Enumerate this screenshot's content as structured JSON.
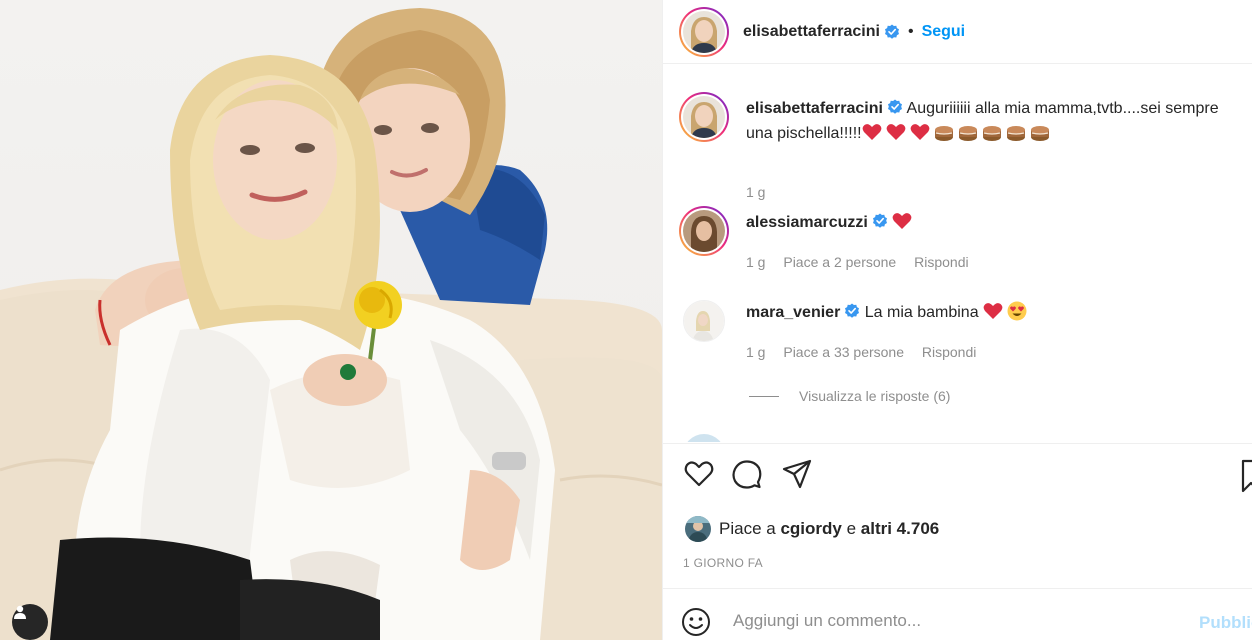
{
  "post": {
    "author": "elisabettaferracini",
    "follow_label": "Segui",
    "separator": "•"
  },
  "comments": [
    {
      "username": "elisabettaferracini",
      "text_line1": "Auguriiiiii alla mia mamma,tvtb....sei sempre",
      "text_line2": "una pischella!!!!!",
      "time": "1 g"
    },
    {
      "username": "alessiamarcuzzi",
      "time": "1 g",
      "likes": "Piace a 2 persone",
      "reply": "Rispondi"
    },
    {
      "username": "mara_venier",
      "text": "La mia bambina",
      "time": "1 g",
      "likes": "Piace a 33 persone",
      "reply": "Rispondi"
    }
  ],
  "view_replies": "Visualizza le risposte (6)",
  "likes": {
    "prefix": "Piace a",
    "user": "cgiordy",
    "middle": "e",
    "others": "altri 4.706"
  },
  "date": "1 GIORNO FA",
  "add_comment": {
    "placeholder": "Aggiungi un commento...",
    "post_label": "Pubblica"
  },
  "icons": [
    "heart-icon",
    "comment-icon",
    "share-icon",
    "bookmark-icon",
    "emoji-icon",
    "verified-icon",
    "user-tag-icon"
  ],
  "colors": {
    "link_blue": "#0095f6",
    "verified_blue": "#3897f0",
    "heart_red": "#ed4956",
    "muted": "#8e8e8e",
    "post_disabled": "#b2dffc"
  }
}
